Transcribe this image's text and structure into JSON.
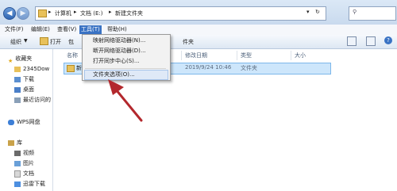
{
  "address": {
    "segments": [
      "计算机",
      "文档 (E:)",
      "新建文件夹"
    ]
  },
  "menubar": [
    {
      "label": "文件(F)"
    },
    {
      "label": "编辑(E)"
    },
    {
      "label": "查看(V)"
    },
    {
      "label": "工具(T)"
    },
    {
      "label": "帮助(H)"
    }
  ],
  "toolbar": {
    "organize": "组织",
    "open": "打开",
    "partial_left": "包",
    "partial_right": "件夹"
  },
  "tools_menu": {
    "items": [
      "映射网络驱动器(N)...",
      "断开网络驱动器(D)...",
      "打开同步中心(S)...",
      "文件夹选项(O)..."
    ]
  },
  "columns": {
    "name": "名称",
    "modified": "修改日期",
    "type": "类型",
    "size": "大小"
  },
  "files": [
    {
      "name_fragment": "新",
      "modified": "2019/9/24 10:46",
      "type": "文件夹"
    }
  ],
  "sidebar": {
    "favorites": "收藏夹",
    "items": [
      "2345Dow",
      "下载",
      "桌面",
      "最近访问的"
    ],
    "wps": "WPS网盘",
    "library": "库",
    "lib_items": [
      "视频",
      "图片",
      "文档",
      "迅雷下载"
    ]
  },
  "colors": {
    "accent": "#2f66b3",
    "selection": "#cde6fb",
    "arrow": "#b3282d"
  }
}
